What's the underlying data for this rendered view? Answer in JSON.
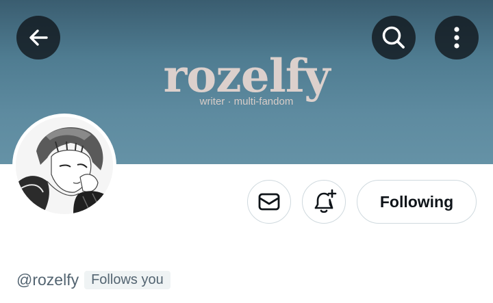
{
  "header": {
    "banner": {
      "title": "rozelfy",
      "subtitle": "writer · multi-fandom",
      "background_color": "#5e8ba0",
      "title_color": "#dcd0cc"
    },
    "actions": {
      "back_icon": "arrow-left-icon",
      "search_icon": "search-icon",
      "more_icon": "more-vertical-icon"
    }
  },
  "profile": {
    "avatar_icon": "anime-avatar-image",
    "handle": "@rozelfy",
    "follows_you": "Follows you"
  },
  "profile_actions": {
    "message_icon": "mail-icon",
    "notify_icon": "bell-plus-icon",
    "following_label": "Following"
  },
  "colors": {
    "text_primary": "#0f1419",
    "text_secondary": "#536471",
    "border": "#cfd9de",
    "badge_background": "#eff3f4"
  }
}
